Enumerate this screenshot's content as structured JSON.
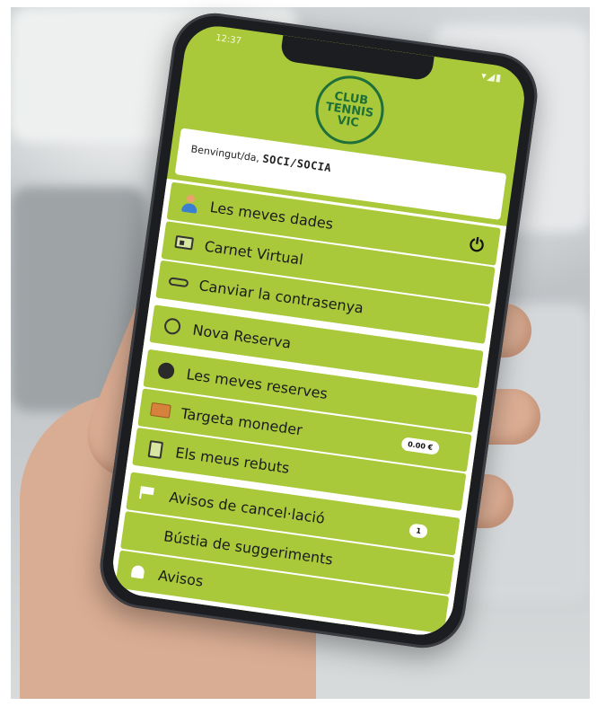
{
  "status_bar": {
    "time": "12:37",
    "icons": "▾◢▮"
  },
  "logo": {
    "line1": "CLUB",
    "line2": "TENNIS",
    "line3": "VIC"
  },
  "welcome": {
    "prefix": "Benvingut/da,",
    "user": "SOCI/SOCIA"
  },
  "power_icon": "⏻",
  "menu": {
    "group1": [
      {
        "label": "Les meves dades",
        "icon": "user-icon"
      },
      {
        "label": "Carnet Virtual",
        "icon": "id-card-icon"
      },
      {
        "label": "Canviar la contrasenya",
        "icon": "key-icon"
      }
    ],
    "group2": [
      {
        "label": "Nova Reserva",
        "icon": "tennis-ball-outline-icon"
      }
    ],
    "group3": [
      {
        "label": "Les meves reserves",
        "icon": "tennis-ball-icon"
      },
      {
        "label": "Targeta moneder",
        "icon": "wallet-icon",
        "badge": "0.00 €"
      },
      {
        "label": "Els meus rebuts",
        "icon": "receipt-icon"
      }
    ],
    "group4": [
      {
        "label": "Avisos de cancel·lació",
        "icon": "flag-icon",
        "badge": "1"
      },
      {
        "label": "Bústia de suggeriments",
        "icon": "blank"
      },
      {
        "label": "Avisos",
        "icon": "bell-icon"
      }
    ]
  },
  "colors": {
    "accent": "#a9c93a",
    "logo_green": "#1f6f3a",
    "phone": "#1c1d20"
  }
}
